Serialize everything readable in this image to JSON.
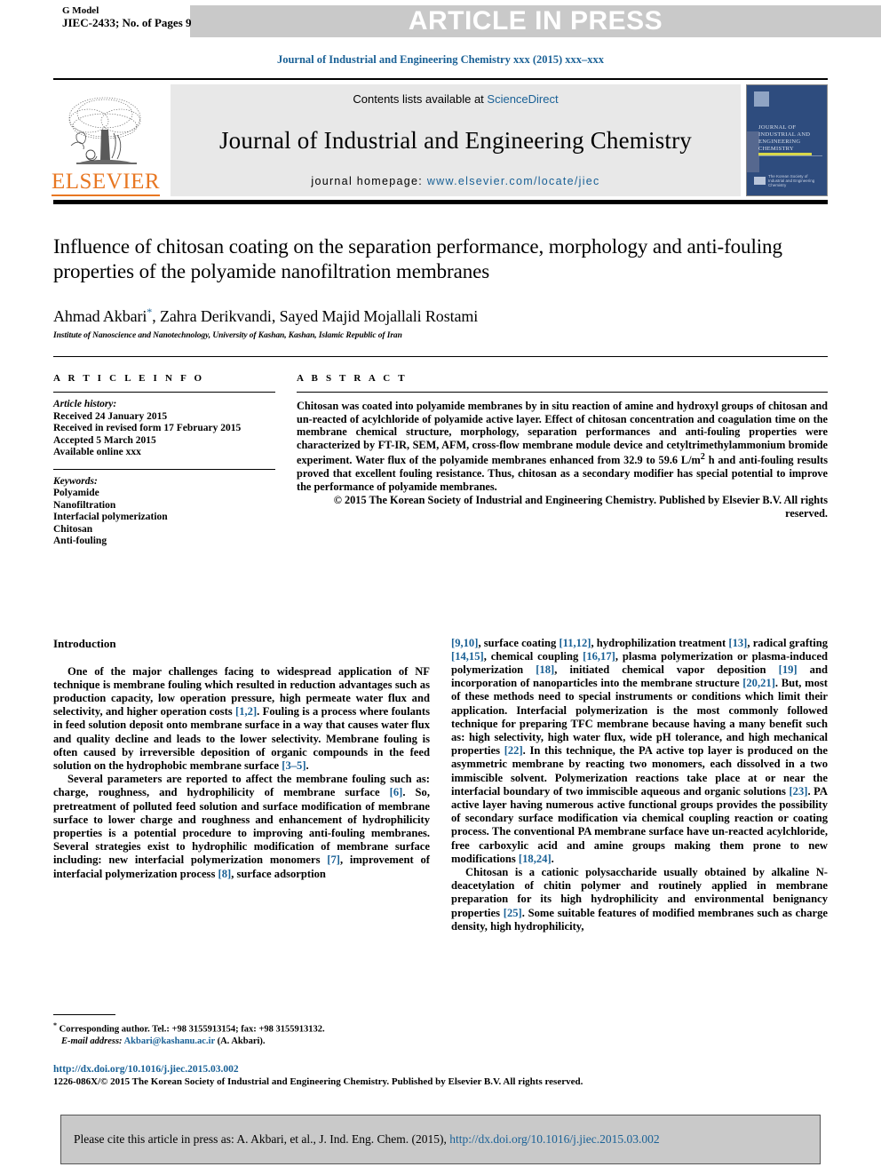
{
  "header": {
    "g_model_label": "G Model",
    "article_id": "JIEC-2433; No. of Pages 9",
    "article_in_press": "ARTICLE IN PRESS",
    "journal_ref": "Journal of Industrial and Engineering Chemistry xxx (2015) xxx–xxx"
  },
  "masthead": {
    "contents_prefix": "Contents lists available at ",
    "sciencedirect": "ScienceDirect",
    "journal_title": "Journal of Industrial and Engineering Chemistry",
    "homepage_label": "journal homepage: ",
    "homepage_url": "www.elsevier.com/locate/jiec",
    "publisher_logo_text": "ELSEVIER",
    "cover": {
      "title_lines": "JOURNAL OF INDUSTRIAL AND ENGINEERING CHEMISTRY",
      "society_text": "The Korean Society of Industrial and Engineering Chemistry"
    }
  },
  "title_block": {
    "title": "Influence of chitosan coating on the separation performance, morphology and anti-fouling properties of the polyamide nanofiltration membranes",
    "authors": "Ahmad Akbari",
    "corresponding_marker": "*",
    "authors_rest": ", Zahra Derikvandi, Sayed Majid Mojallali Rostami",
    "affiliation": "Institute of Nanoscience and Nanotechnology, University of Kashan, Kashan, Islamic Republic of Iran"
  },
  "article_info": {
    "heading": "A R T I C L E   I N F O",
    "history_label": "Article history:",
    "history": [
      "Received 24 January 2015",
      "Received in revised form 17 February 2015",
      "Accepted 5 March 2015",
      "Available online xxx"
    ],
    "keywords_label": "Keywords:",
    "keywords": [
      "Polyamide",
      "Nanofiltration",
      "Interfacial polymerization",
      "Chitosan",
      "Anti-fouling"
    ]
  },
  "abstract": {
    "heading": "A B S T R A C T",
    "body": "Chitosan was coated into polyamide membranes by in situ reaction of amine and hydroxyl groups of chitosan and un-reacted of acylchloride of polyamide active layer. Effect of chitosan concentration and coagulation time on the membrane chemical structure, morphology, separation performances and anti-fouling properties were characterized by FT-IR, SEM, AFM, cross-flow membrane module device and cetyltrimethylammonium bromide experiment. Water flux of the polyamide membranes enhanced from 32.9 to 59.6 L/m2 h and anti-fouling results proved that excellent fouling resistance. Thus, chitosan as a secondary modifier has special potential to improve the performance of polyamide membranes.",
    "copyright": "© 2015 The Korean Society of Industrial and Engineering Chemistry. Published by Elsevier B.V. All rights reserved."
  },
  "body": {
    "section_heading": "Introduction",
    "left_paragraphs": [
      "One of the major challenges facing to widespread application of NF technique is membrane fouling which resulted in reduction advantages such as production capacity, low operation pressure, high permeate water flux and selectivity, and higher operation costs [1,2]. Fouling is a process where foulants in feed solution deposit onto membrane surface in a way that causes water flux and quality decline and leads to the lower selectivity. Membrane fouling is often caused by irreversible deposition of organic compounds in the feed solution on the hydrophobic membrane surface [3–5].",
      "Several parameters are reported to affect the membrane fouling such as: charge, roughness, and hydrophilicity of membrane surface [6]. So, pretreatment of polluted feed solution and surface modification of membrane surface to lower charge and roughness and enhancement of hydrophilicity properties is a potential procedure to improving anti-fouling membranes. Several strategies exist to hydrophilic modification of membrane surface including: new interfacial polymerization monomers [7], improvement of interfacial polymerization process [8], surface adsorption"
    ],
    "right_paragraphs": [
      "[9,10], surface coating [11,12], hydrophilization treatment [13], radical grafting [14,15], chemical coupling [16,17], plasma polymerization or plasma-induced polymerization [18], initiated chemical vapor deposition [19] and incorporation of nanoparticles into the membrane structure [20,21]. But, most of these methods need to special instruments or conditions which limit their application. Interfacial polymerization is the most commonly followed technique for preparing TFC membrane because having a many benefit such as: high selectivity, high water flux, wide pH tolerance, and high mechanical properties [22]. In this technique, the PA active top layer is produced on the asymmetric membrane by reacting two monomers, each dissolved in a two immiscible solvent. Polymerization reactions take place at or near the interfacial boundary of two immiscible aqueous and organic solutions [23]. PA active layer having numerous active functional groups provides the possibility of secondary surface modification via chemical coupling reaction or coating process. The conventional PA membrane surface have un-reacted acylchloride, free carboxylic acid and amine groups making them prone to new modifications [18,24].",
      "Chitosan is a cationic polysaccharide usually obtained by alkaline N-deacetylation of chitin polymer and routinely applied in membrane preparation for its high hydrophilicity and environmental benignancy properties [25]. Some suitable features of modified membranes such as charge density, high hydrophilicity,"
    ]
  },
  "footnote": {
    "marker": "*",
    "corresponding": " Corresponding author. Tel.: +98 3155913154; fax: +98 3155913132.",
    "email_label": "E-mail address:",
    "email": "Akbari@kashanu.ac.ir",
    "email_suffix": " (A. Akbari)."
  },
  "bottom_meta": {
    "doi": "http://dx.doi.org/10.1016/j.jiec.2015.03.002",
    "issn_line": "1226-086X/© 2015 The Korean Society of Industrial and Engineering Chemistry. Published by Elsevier B.V. All rights reserved."
  },
  "cite_box": {
    "prefix": "Please cite this article in press as: A. Akbari, et al., J. Ind. Eng. Chem. (2015), ",
    "url": "http://dx.doi.org/10.1016/j.jiec.2015.03.002"
  },
  "colors": {
    "link": "#1a6196",
    "band": "#c9c9c9",
    "elsevier_orange": "#E87722",
    "cover_blue": "#2e4c7e"
  }
}
